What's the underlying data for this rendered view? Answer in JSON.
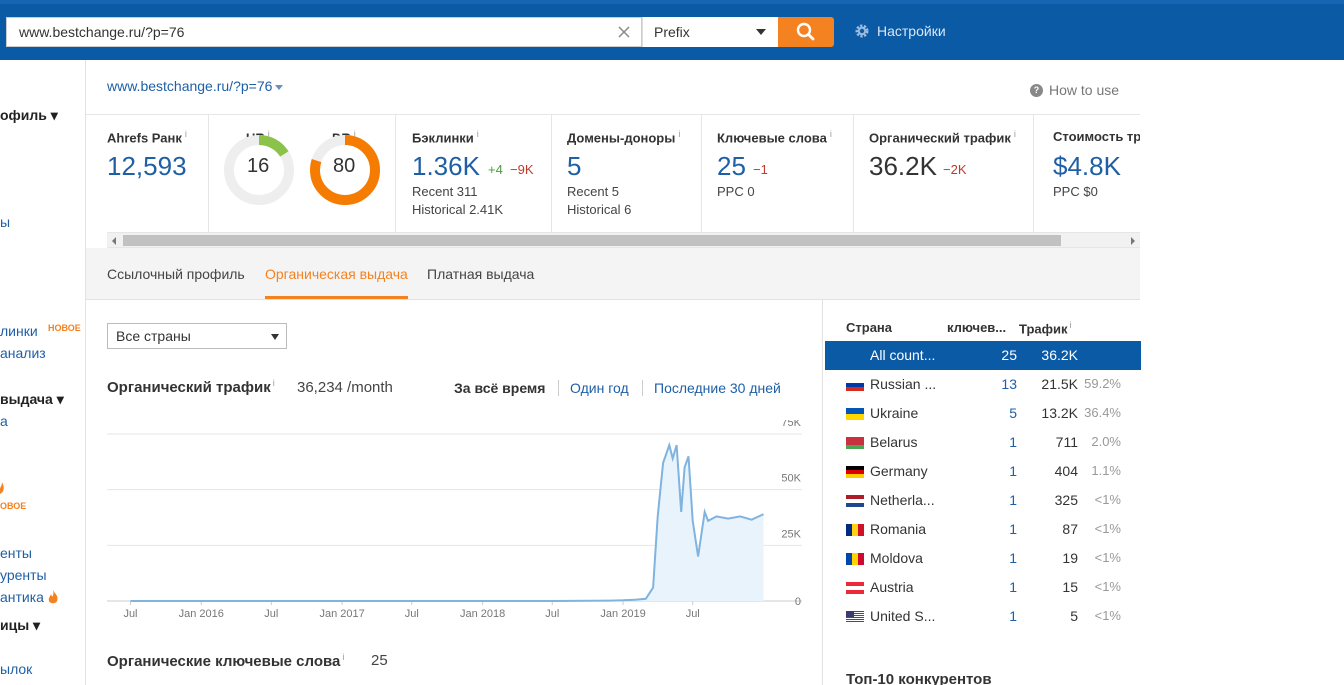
{
  "topbar": {
    "url": "www.bestchange.ru/?p=76",
    "mode": "Prefix",
    "settings_label": "Настройки"
  },
  "leftnav": {
    "items": [
      {
        "text": "офиль ▾",
        "kind": "head"
      },
      {
        "text": "ы",
        "kind": "link"
      },
      {
        "text": "линки",
        "kind": "link",
        "badge": "НОВОЕ"
      },
      {
        "text": "анализ",
        "kind": "link"
      },
      {
        "text": "выдача ▾",
        "kind": "head"
      },
      {
        "text": "а",
        "kind": "link"
      },
      {
        "text": "ОВОЕ",
        "kind": "new"
      },
      {
        "text": "енты",
        "kind": "link"
      },
      {
        "text": "уренты",
        "kind": "link"
      },
      {
        "text": "антика",
        "kind": "link"
      },
      {
        "text": "ицы ▾",
        "kind": "head"
      },
      {
        "text": "ылок",
        "kind": "link"
      }
    ]
  },
  "site": {
    "url": "www.bestchange.ru/?p=76",
    "how_to_use": "How to use"
  },
  "metrics": {
    "ahrefs_rank": {
      "label": "Ahrefs Ранк",
      "value": "12,593"
    },
    "ur": {
      "label": "UR",
      "value": "16",
      "score": 16
    },
    "dr": {
      "label": "DR",
      "value": "80",
      "score": 80
    },
    "backlinks": {
      "label": "Бэклинки",
      "value": "1.36K",
      "delta_up": "+4",
      "delta_down": "−9K",
      "recent": "Recent 311",
      "historical": "Historical 2.41K"
    },
    "domains": {
      "label": "Домены-доноры",
      "value": "5",
      "recent": "Recent 5",
      "historical": "Historical 6"
    },
    "keywords": {
      "label": "Ключевые слова",
      "value": "25",
      "delta_down": "−1",
      "ppc": "PPC 0"
    },
    "organic_traffic": {
      "label": "Органический трафик",
      "value": "36.2K",
      "delta_down": "−2K"
    },
    "traffic_cost": {
      "label": "Стоимость тр",
      "value": "$4.8K",
      "ppc": "PPC $0"
    },
    "info_mark": "i"
  },
  "tabs": [
    {
      "label": "Ссылочный профиль",
      "active": false
    },
    {
      "label": "Органическая выдача",
      "active": true
    },
    {
      "label": "Платная выдача",
      "active": false
    }
  ],
  "filters": {
    "country_select": "Все страны"
  },
  "traffic": {
    "title": "Органический трафик",
    "value": "36,234 /month",
    "ranges": {
      "all": "За всё время",
      "year": "Один год",
      "days30": "Последние 30 дней"
    }
  },
  "chart_data": {
    "type": "area",
    "title": "",
    "xlabel": "",
    "ylabel": "",
    "x_tick_labels": [
      "Jul",
      "Jan 2016",
      "Jul",
      "Jan 2017",
      "Jul",
      "Jan 2018",
      "Jul",
      "Jan 2019",
      "Jul"
    ],
    "y_tick_labels": [
      "75K",
      "50K",
      "25K",
      "0"
    ],
    "ylim": [
      0,
      75000
    ],
    "grid": true,
    "color": "#7fb3e0",
    "series": [
      {
        "x": [
          "2015-07",
          "2016-01",
          "2016-07",
          "2017-01",
          "2017-07",
          "2018-01",
          "2018-07",
          "2018-12",
          "2019-01",
          "2019-02",
          "2019-03",
          "2019-03-20",
          "2019-04",
          "2019-04-15",
          "2019-05",
          "2019-05-10",
          "2019-05-20",
          "2019-06",
          "2019-06-10",
          "2019-06-20",
          "2019-07",
          "2019-07-15",
          "2019-08",
          "2019-08-10",
          "2019-09",
          "2019-10",
          "2019-11",
          "2019-12",
          "2020-01"
        ],
        "values": [
          0,
          0,
          0,
          0,
          0,
          0,
          0,
          200,
          300,
          600,
          1000,
          6000,
          38000,
          62000,
          70000,
          64000,
          70000,
          40000,
          60000,
          65000,
          36000,
          20000,
          40000,
          36000,
          38000,
          37000,
          38000,
          36500,
          39000
        ]
      }
    ]
  },
  "keywords": {
    "title": "Органические ключевые слова",
    "value": "25"
  },
  "countries": {
    "headers": {
      "country": "Страна",
      "keywords": "ключев...",
      "traffic": "Трафик"
    },
    "rows": [
      {
        "name": "All count...",
        "kw": "25",
        "traffic": "36.2K",
        "pct": "",
        "selected": true,
        "flag": "none"
      },
      {
        "name": "Russian ...",
        "kw": "13",
        "traffic": "21.5K",
        "pct": "59.2%",
        "flag": "ru"
      },
      {
        "name": "Ukraine",
        "kw": "5",
        "traffic": "13.2K",
        "pct": "36.4%",
        "flag": "ua"
      },
      {
        "name": "Belarus",
        "kw": "1",
        "traffic": "711",
        "pct": "2.0%",
        "flag": "by"
      },
      {
        "name": "Germany",
        "kw": "1",
        "traffic": "404",
        "pct": "1.1%",
        "flag": "de"
      },
      {
        "name": "Netherla...",
        "kw": "1",
        "traffic": "325",
        "pct": "<1%",
        "flag": "nl"
      },
      {
        "name": "Romania",
        "kw": "1",
        "traffic": "87",
        "pct": "<1%",
        "flag": "ro"
      },
      {
        "name": "Moldova",
        "kw": "1",
        "traffic": "19",
        "pct": "<1%",
        "flag": "md"
      },
      {
        "name": "Austria",
        "kw": "1",
        "traffic": "15",
        "pct": "<1%",
        "flag": "at"
      },
      {
        "name": "United S...",
        "kw": "1",
        "traffic": "5",
        "pct": "<1%",
        "flag": "us"
      }
    ],
    "top10_title": "Топ-10 конкурентов"
  }
}
